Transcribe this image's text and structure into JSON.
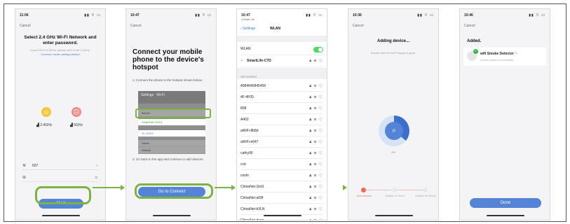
{
  "screens": [
    {
      "status_time": "11:06",
      "cancel": "Cancel",
      "title": "Select 2.4 GHz Wi-Fi Network and enter password.",
      "subtitle": "If your Wi-Fi is 5GHz, please set it to be 2.4GHz.",
      "link": "Common router setting method",
      "band_ok": "2.4GHz",
      "band_bad": "5GHz",
      "ssid_value": "607",
      "ssid_right": "↻",
      "password_value": "",
      "password_right": "👁",
      "next": "Next"
    },
    {
      "status_time": "10:47",
      "cancel": "Cancel",
      "title": "Connect your mobile phone to the device's hotspot",
      "step1": "1. Connect the phone to the hotspot shown below.",
      "shot_back": "Settings",
      "shot_title": "Wi-Fi",
      "shot_wlan": "WLAN",
      "shot_ssid": "SmartLife-XXXX",
      "shot_ssid2": "SL-XXXX",
      "shot_row1": "Home",
      "shot_row2": "Home2",
      "step2": "2. Go back to the app and continue to add devices.",
      "go": "Go to Connect"
    },
    {
      "status_time": "10:47",
      "status_sub": "◂ Smart Life",
      "back": "Settings",
      "title": "WLAN",
      "wlan_label": "WLAN",
      "connected": "SmartLife-C7D",
      "networks_header": "NETWORKS",
      "networks": [
        "4084645845456",
        "4F-4F05",
        "808",
        "A402",
        "aWiFi-8b8d",
        "aWiFi-e647",
        "cathy90",
        "ccb",
        "ceshi",
        "ChinaNet-1bd1",
        "ChinaNet-a09f",
        "ChinaNet-b3LN",
        "ChinaNet-dyan"
      ]
    },
    {
      "status_time": "10:36",
      "cancel": "Cancel",
      "title": "Adding device...",
      "subtitle": "Ensure that the Wi-Fi signal is good.",
      "percent": "3%",
      "progress": 0.36,
      "steps": [
        "Scan devices",
        "Register to Cloud",
        "Initialize the device"
      ]
    },
    {
      "status_time": "10:46",
      "cancel": "Cancel",
      "added": "Added.",
      "device_name": "wifi Smoke Detector",
      "device_status": "Device added successfully",
      "done": "Done"
    }
  ],
  "colors": {
    "accent": "#5584d6",
    "highlight": "#7db343",
    "wifi_on": "#4cd964",
    "alert": "#ef6b55"
  }
}
